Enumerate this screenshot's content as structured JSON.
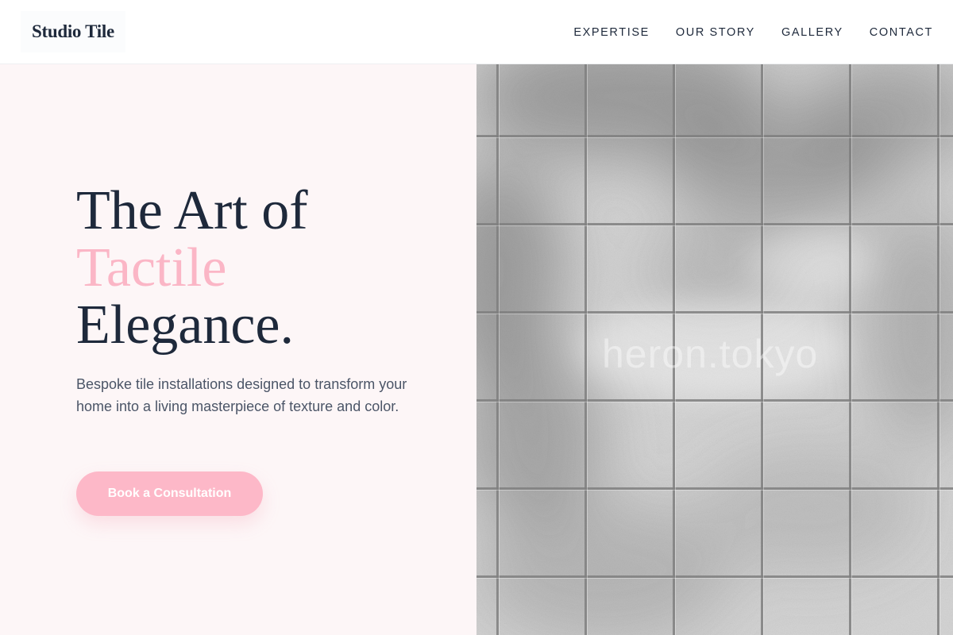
{
  "header": {
    "logo": "Studio Tile",
    "nav": [
      {
        "label": "EXPERTISE"
      },
      {
        "label": "OUR STORY"
      },
      {
        "label": "GALLERY"
      },
      {
        "label": "CONTACT"
      }
    ]
  },
  "hero": {
    "headline_line1": "The Art of",
    "headline_accent": "Tactile",
    "headline_line3": "Elegance.",
    "subtitle": "Bespoke tile installations designed to transform your home into a living masterpiece of texture and color.",
    "cta_label": "Book a Consultation"
  },
  "image": {
    "watermark": "heron.tokyo"
  },
  "colors": {
    "accent": "#fbb6c6",
    "cta_background": "#fdb8c8",
    "text_dark": "#1e293b",
    "text_muted": "#4b5567",
    "page_background": "#fdf6f7"
  }
}
